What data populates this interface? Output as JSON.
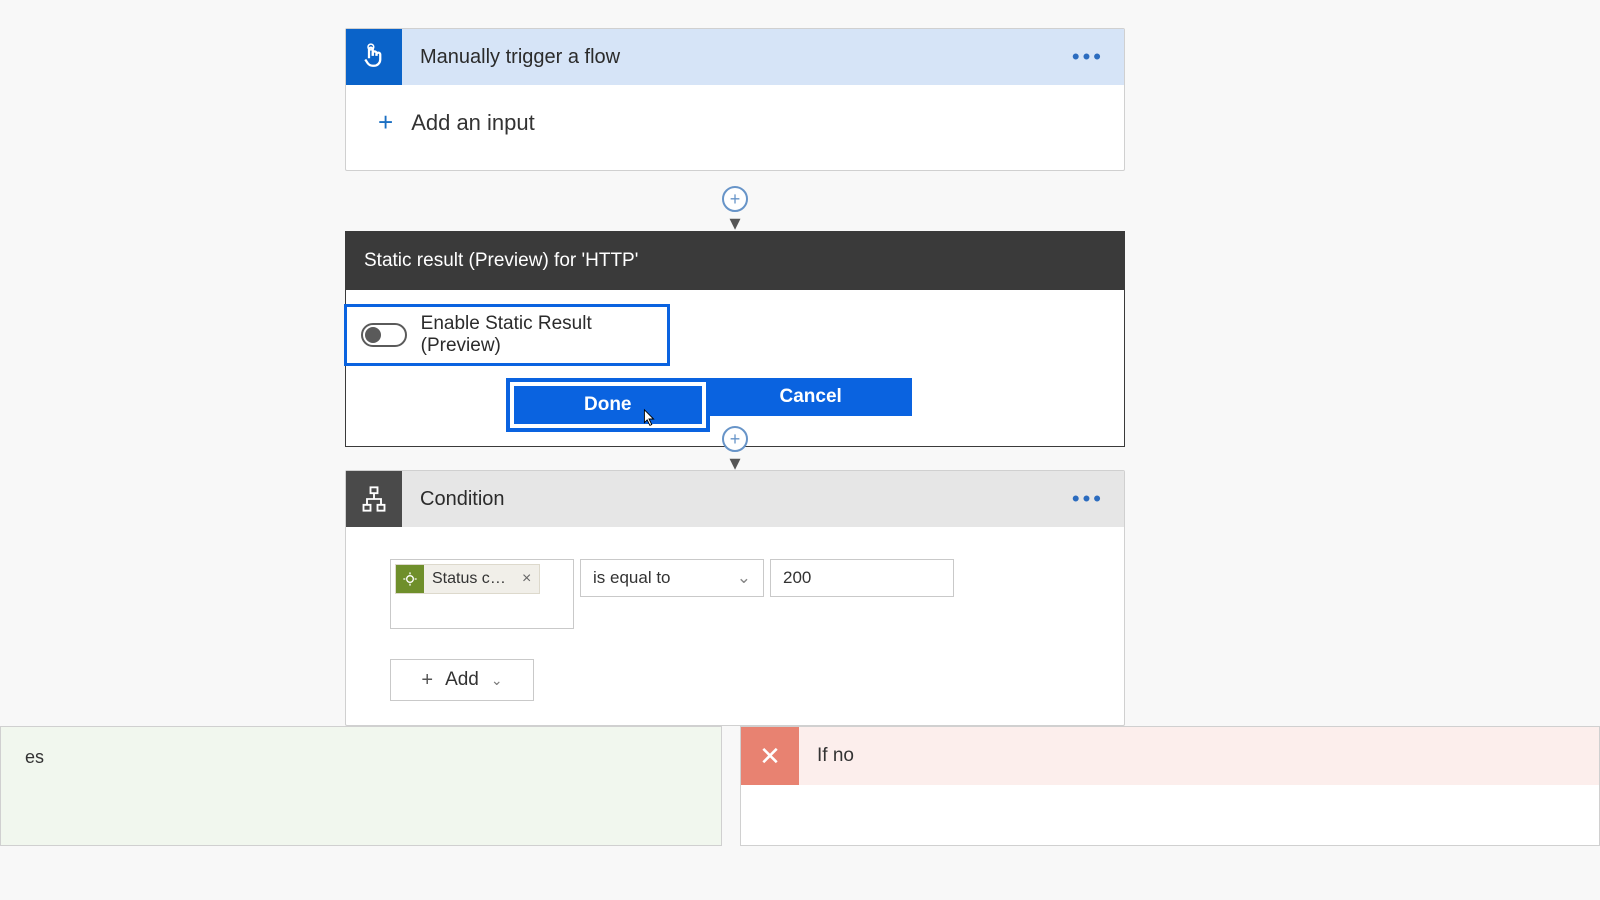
{
  "trigger": {
    "title": "Manually trigger a flow",
    "add_input_label": "Add an input"
  },
  "static_result": {
    "header": "Static result (Preview) for 'HTTP'",
    "toggle_label": "Enable Static Result (Preview)",
    "done_label": "Done",
    "cancel_label": "Cancel"
  },
  "condition": {
    "title": "Condition",
    "token_label": "Status co...",
    "operator": "is equal to",
    "value": "200",
    "add_label": "Add"
  },
  "branches": {
    "yes_suffix": "es",
    "no_label": "If no"
  }
}
